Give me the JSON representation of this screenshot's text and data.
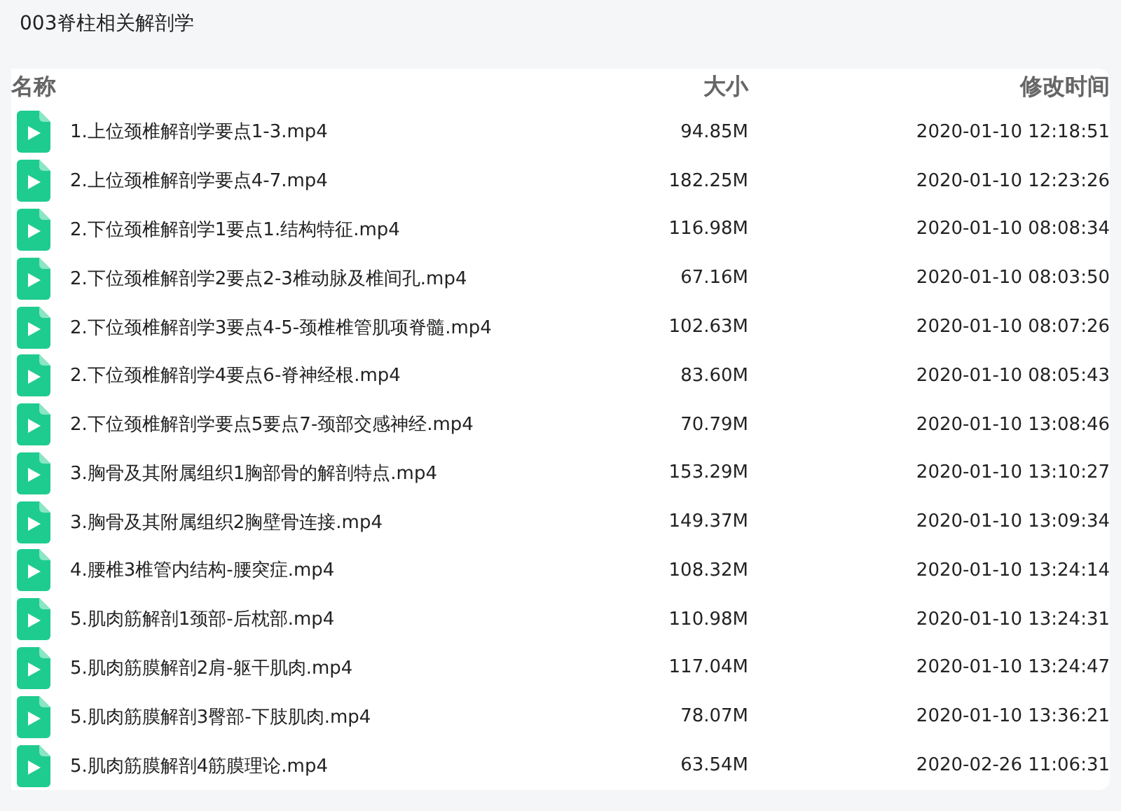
{
  "folder_title": "003脊柱相关解剖学",
  "columns": [
    "名称",
    "大小",
    "修改时间"
  ],
  "files": [
    {
      "name": "1.上位颈椎解剖学要点1-3.mp4",
      "size": "94.85M",
      "modified": "2020-01-10 12:18:51"
    },
    {
      "name": "2.上位颈椎解剖学要点4-7.mp4",
      "size": "182.25M",
      "modified": "2020-01-10 12:23:26"
    },
    {
      "name": "2.下位颈椎解剖学1要点1.结构特征.mp4",
      "size": "116.98M",
      "modified": "2020-01-10 08:08:34"
    },
    {
      "name": "2.下位颈椎解剖学2要点2-3椎动脉及椎间孔.mp4",
      "size": "67.16M",
      "modified": "2020-01-10 08:03:50"
    },
    {
      "name": "2.下位颈椎解剖学3要点4-5-颈椎椎管肌项脊髓.mp4",
      "size": "102.63M",
      "modified": "2020-01-10 08:07:26"
    },
    {
      "name": "2.下位颈椎解剖学4要点6-脊神经根.mp4",
      "size": "83.60M",
      "modified": "2020-01-10 08:05:43"
    },
    {
      "name": "2.下位颈椎解剖学要点5要点7-颈部交感神经.mp4",
      "size": "70.79M",
      "modified": "2020-01-10 13:08:46"
    },
    {
      "name": "3.胸骨及其附属组织1胸部骨的解剖特点.mp4",
      "size": "153.29M",
      "modified": "2020-01-10 13:10:27"
    },
    {
      "name": "3.胸骨及其附属组织2胸壁骨连接.mp4",
      "size": "149.37M",
      "modified": "2020-01-10 13:09:34"
    },
    {
      "name": "4.腰椎3椎管内结构-腰突症.mp4",
      "size": "108.32M",
      "modified": "2020-01-10 13:24:14"
    },
    {
      "name": "5.肌肉筋解剖1颈部-后枕部.mp4",
      "size": "110.98M",
      "modified": "2020-01-10 13:24:31"
    },
    {
      "name": "5.肌肉筋膜解剖2肩-躯干肌肉.mp4",
      "size": "117.04M",
      "modified": "2020-01-10 13:24:47"
    },
    {
      "name": "5.肌肉筋膜解剖3臀部-下肢肌肉.mp4",
      "size": "78.07M",
      "modified": "2020-01-10 13:36:21"
    },
    {
      "name": "5.肌肉筋膜解剖4筋膜理论.mp4",
      "size": "63.54M",
      "modified": "2020-02-26 11:06:31"
    }
  ]
}
